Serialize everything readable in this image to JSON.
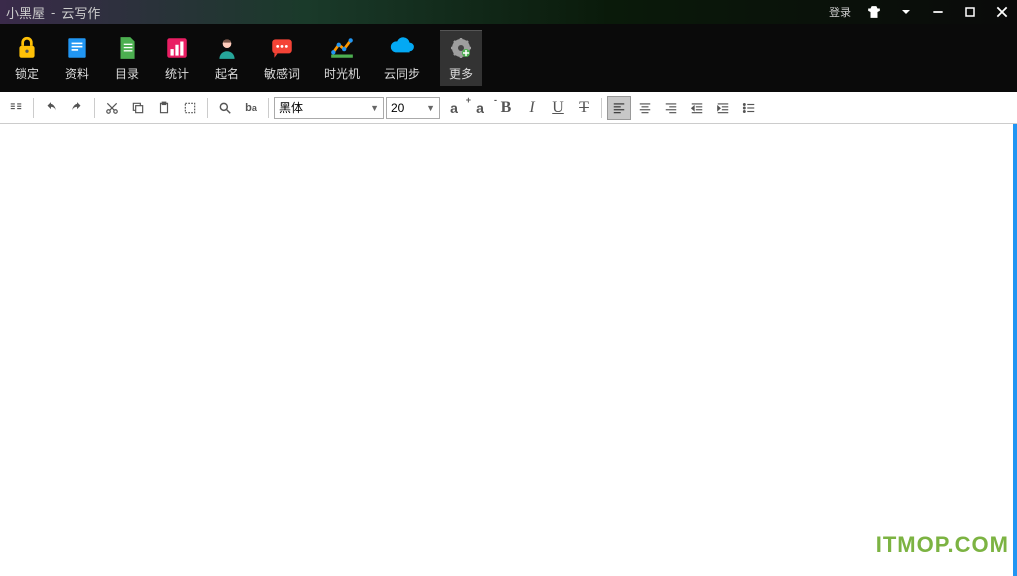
{
  "title": {
    "app": "小黑屋",
    "sep": "-",
    "sub": "云写作"
  },
  "titlebar": {
    "login": "登录"
  },
  "toolbar": {
    "lock": "锁定",
    "info": "资料",
    "toc": "目录",
    "stats": "统计",
    "naming": "起名",
    "sensitive": "敏感词",
    "time": "时光机",
    "cloud": "云同步",
    "more": "更多"
  },
  "format": {
    "font_name": "黑体",
    "font_size": "20",
    "bold": "B",
    "italic": "I",
    "underline": "U",
    "strike": "T"
  },
  "watermark": "ITMOP.COM"
}
